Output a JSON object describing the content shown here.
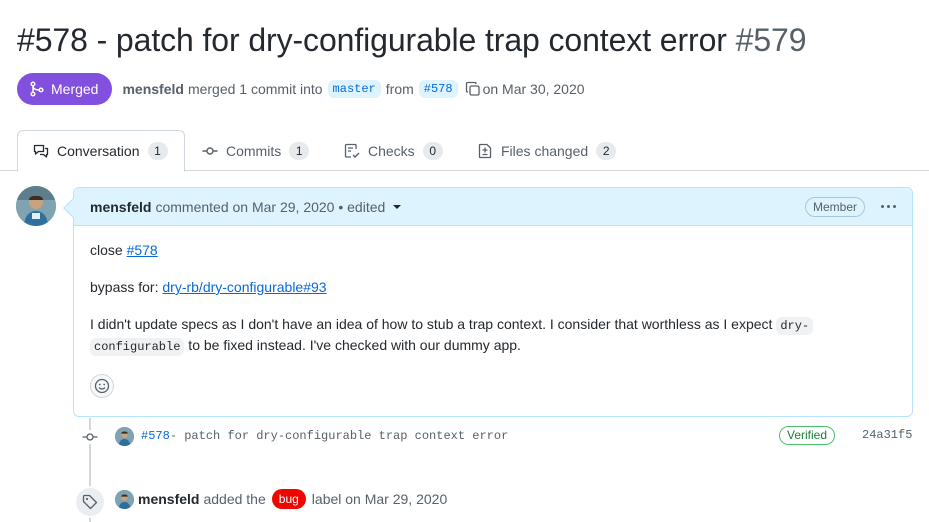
{
  "pr": {
    "title": "#578 - patch for dry-configurable trap context error",
    "number": "#579",
    "state": "Merged",
    "author": "mensfeld",
    "merge_text": "merged 1 commit into",
    "base_branch": "master",
    "from_text": "from",
    "head_branch": "#578",
    "date_text": "on Mar 30, 2020"
  },
  "tabs": [
    {
      "label": "Conversation",
      "count": "1",
      "icon": "comment-discussion-icon"
    },
    {
      "label": "Commits",
      "count": "1",
      "icon": "git-commit-icon"
    },
    {
      "label": "Checks",
      "count": "0",
      "icon": "checklist-icon"
    },
    {
      "label": "Files changed",
      "count": "2",
      "icon": "file-diff-icon"
    }
  ],
  "comment": {
    "author": "mensfeld",
    "meta": "commented on Mar 29, 2020 • edited",
    "role": "Member",
    "line1_prefix": "close ",
    "line1_link": "#578",
    "line2_prefix": "bypass for: ",
    "line2_link": "dry-rb/dry-configurable#93",
    "line3_a": "I didn't update specs as I don't have an idea of how to stub a trap context. I consider that worthless as I expect ",
    "line3_code1": "dry-",
    "line3_code2": "configurable",
    "line3_b": " to be fixed instead. I've checked with our dummy app."
  },
  "commit": {
    "ref": "#578",
    "message": " - patch for dry-configurable trap context error",
    "verified": "Verified",
    "sha": "24a31f5"
  },
  "label_event": {
    "author": "mensfeld",
    "text_a": "added the",
    "label": "bug",
    "text_b": "label on Mar 29, 2020",
    "label_color": "#ee0701"
  },
  "colors": {
    "merged": "#8250df",
    "link": "#0969da",
    "comment_header": "#ddf4ff"
  }
}
